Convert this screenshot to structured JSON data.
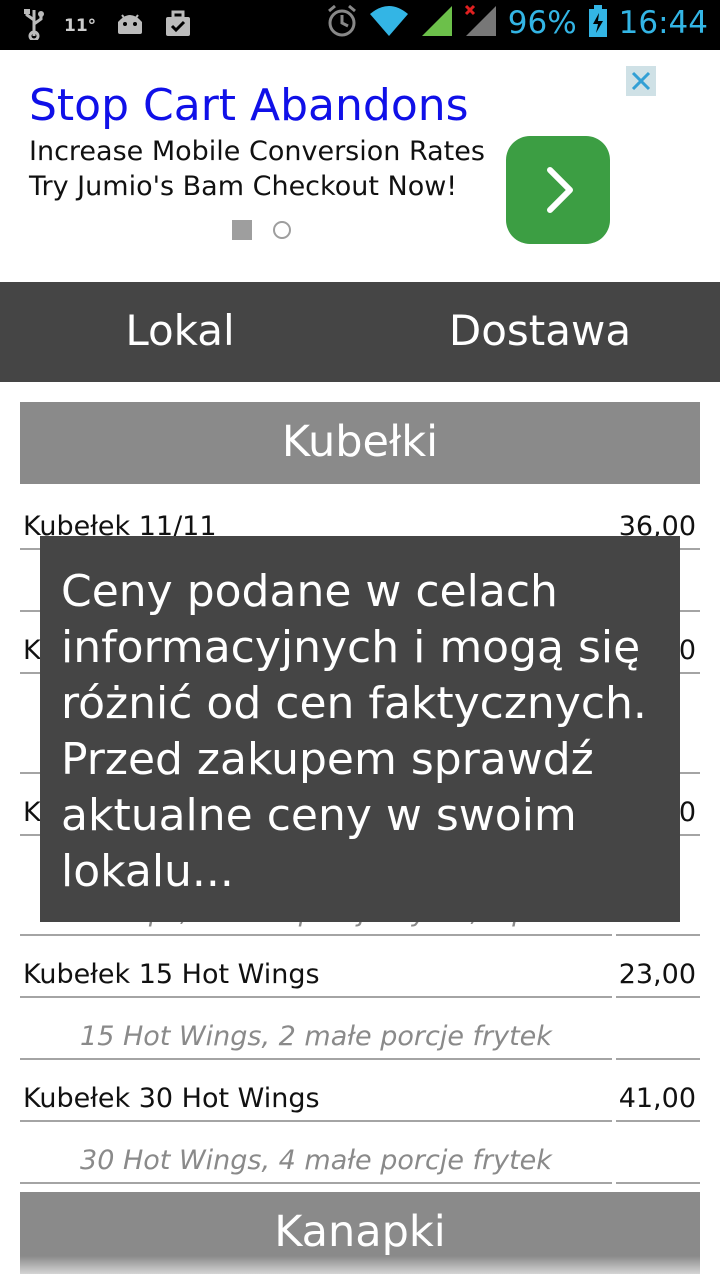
{
  "status_bar": {
    "temperature": "11°",
    "battery_percent": "96%",
    "time": "16:44"
  },
  "ad": {
    "title": "Stop Cart Abandons",
    "line1": "Increase Mobile Conversion Rates",
    "line2": "Try Jumio's Bam Checkout Now!",
    "button_color": "#3c9e43"
  },
  "tabs": [
    {
      "label": "Lokal"
    },
    {
      "label": "Dostawa"
    }
  ],
  "menu": {
    "category1": "Kubełki",
    "items": [
      {
        "name": "Kubełek 11/11",
        "price": "36,00"
      },
      {
        "name": "Kubełek 15 Hot Wings",
        "price": "23,00",
        "desc": "15 Hot Wings, 2 małe porcje frytek"
      },
      {
        "name": "Kubełek 30 Hot Wings",
        "price": "41,00",
        "desc": "30 Hot Wings, 4 małe porcje frytek"
      }
    ],
    "partial_text": {
      "hidden_initial": "K",
      "hidden_price_digit": "0",
      "strips_desc": "Strips, 2 małe porcje frytek, dip"
    },
    "category2": "Kanapki"
  },
  "toast": {
    "message": "Ceny podane w celach informacyjnych i mogą się różnić od cen faktycznych. Przed zakupem sprawdź aktualne ceny w swoim lokalu..."
  },
  "colors": {
    "tab_bar": "#454545",
    "category_header": "#8a8a8a",
    "accent": "#33b5e5",
    "ad_title": "#1010e8"
  }
}
